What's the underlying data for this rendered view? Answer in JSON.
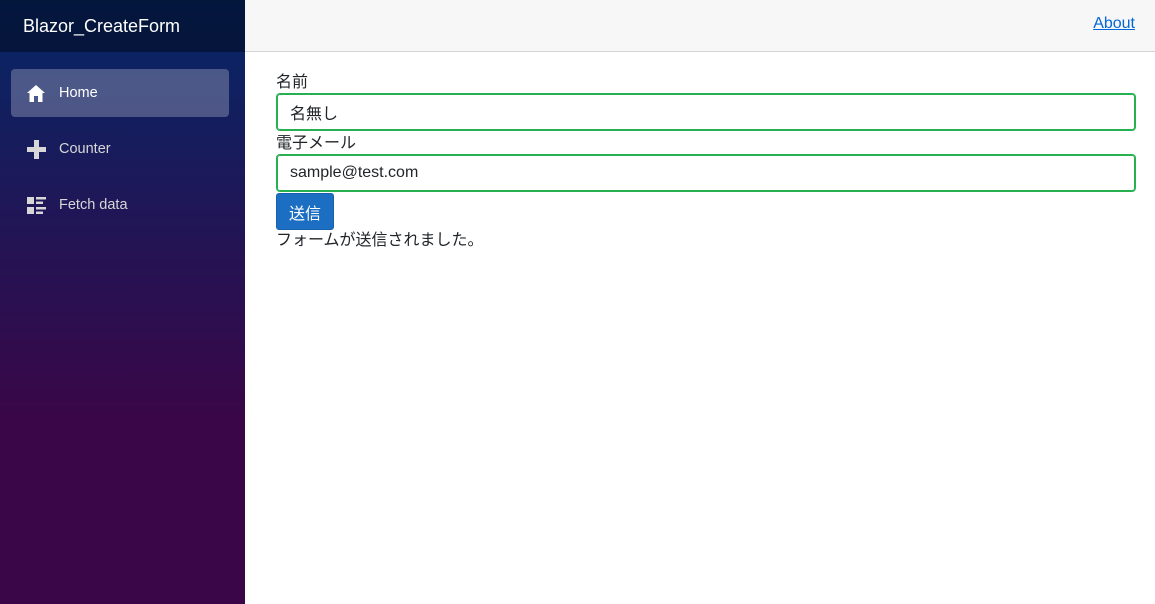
{
  "app": {
    "brand": "Blazor_CreateForm"
  },
  "sidebar": {
    "items": [
      {
        "label": "Home",
        "icon": "home-icon",
        "active": true
      },
      {
        "label": "Counter",
        "icon": "plus-icon",
        "active": false
      },
      {
        "label": "Fetch data",
        "icon": "list-rich-icon",
        "active": false
      }
    ]
  },
  "header": {
    "about_label": "About"
  },
  "form": {
    "name_label": "名前",
    "name_value": "名無し",
    "email_label": "電子メール",
    "email_value": "sample@test.com",
    "submit_label": "送信",
    "status_message": "フォームが送信されました。"
  },
  "colors": {
    "sidebar_gradient_top": "#052767",
    "sidebar_gradient_bottom": "#3a0647",
    "link": "#0366d6",
    "button": "#1b6ec2",
    "valid_border": "#26b050"
  }
}
